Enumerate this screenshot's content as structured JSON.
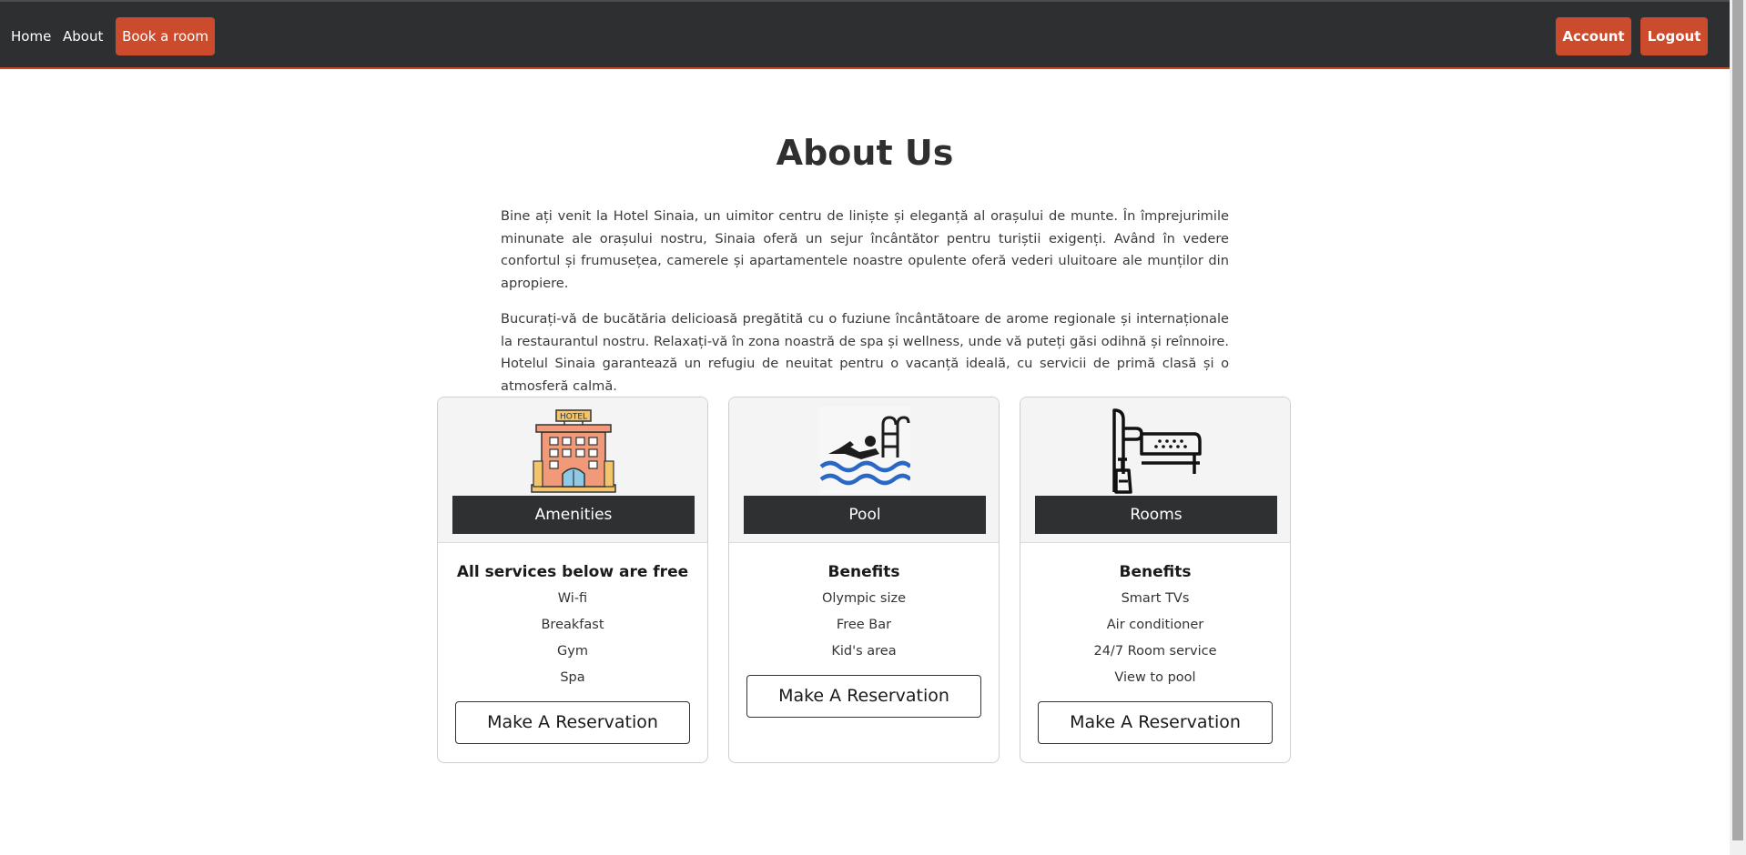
{
  "navbar": {
    "home_label": "Home",
    "about_label": "About",
    "book_label": "Book a room",
    "account_label": "Account",
    "logout_label": "Logout"
  },
  "colors": {
    "navbar_bg": "#2d2f30",
    "accent": "#cc4b2c",
    "card_label_bg": "#2f3031"
  },
  "about": {
    "title": "About Us",
    "paragraphs": [
      "Bine ați venit la Hotel Sinaia, un uimitor centru de liniște și eleganță al orașului de munte. În împrejurimile minunate ale orașului nostru, Sinaia oferă un sejur încântător pentru turiștii exigenți. Având în vedere confortul și frumusețea, camerele și apartamentele noastre opulente oferă vederi uluitoare ale munților din apropiere.",
      "Bucurați-vă de bucătăria delicioasă pregătită cu o fuziune încântătoare de arome regionale și internaționale la restaurantul nostru. Relaxați-vă în zona noastră de spa și wellness, unde vă puteți găsi odihnă și reînnoire. Hotelul Sinaia garantează un refugiu de neuitat pentru o vacanță ideală, cu servicii de primă clasă și o atmosferă calmă."
    ]
  },
  "cards": [
    {
      "icon": "hotel-building-icon",
      "label": "Amenities",
      "heading": "All services below are free",
      "features": [
        "Wi-fi",
        "Breakfast",
        "Gym",
        "Spa"
      ],
      "button": "Make A Reservation"
    },
    {
      "icon": "swimming-pool-icon",
      "label": "Pool",
      "heading": "Benefits",
      "features": [
        "Olympic size",
        "Free Bar",
        "Kid's area"
      ],
      "button": "Make A Reservation"
    },
    {
      "icon": "hotel-bed-icon",
      "label": "Rooms",
      "heading": "Benefits",
      "features": [
        "Smart TVs",
        "Air conditioner",
        "24/7 Room service",
        "View to pool"
      ],
      "button": "Make A Reservation"
    }
  ]
}
